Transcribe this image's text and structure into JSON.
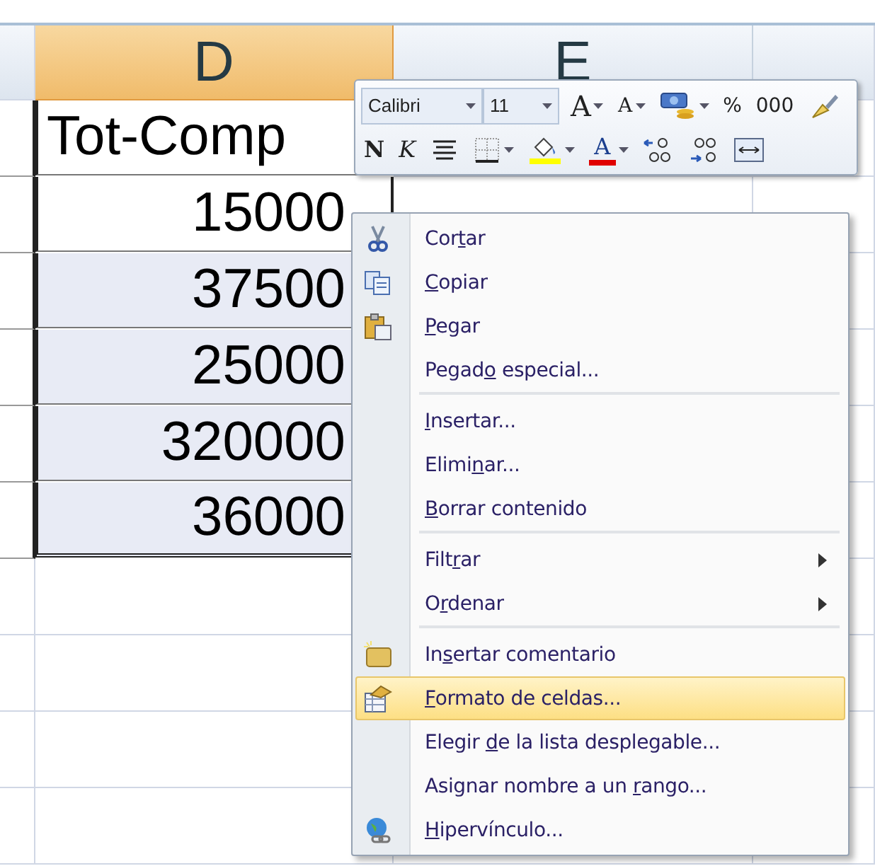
{
  "columns": [
    {
      "label": "D",
      "selected": true
    },
    {
      "label": "E",
      "selected": false
    }
  ],
  "rows": [
    {
      "cell": "Tot-Comp",
      "kind": "header",
      "selected": false
    },
    {
      "cell": "15000",
      "kind": "number",
      "selected": false
    },
    {
      "cell": "37500",
      "kind": "number",
      "selected": true
    },
    {
      "cell": "25000",
      "kind": "number",
      "selected": true
    },
    {
      "cell": "320000",
      "kind": "number",
      "selected": true
    },
    {
      "cell": "36000",
      "kind": "number",
      "selected": true
    }
  ],
  "mini_toolbar": {
    "font": "Calibri",
    "size": "11",
    "row_1": [
      {
        "kind": "grow",
        "text": "A"
      },
      {
        "kind": "shrink",
        "text": "A"
      },
      {
        "kind": "currency"
      },
      {
        "kind": "text",
        "text": "%"
      },
      {
        "kind": "text",
        "text": "000"
      },
      {
        "kind": "brush"
      }
    ],
    "row_2": [
      {
        "kind": "bold",
        "text": "N"
      },
      {
        "kind": "italic",
        "text": "K"
      },
      {
        "kind": "center"
      },
      {
        "kind": "borders"
      },
      {
        "kind": "fill"
      },
      {
        "kind": "fontcolor",
        "text": "A"
      },
      {
        "kind": "incdec"
      },
      {
        "kind": "decdec"
      },
      {
        "kind": "merge"
      }
    ]
  },
  "context_menu": [
    {
      "kind": "cut",
      "before": "Cor",
      "key": "t",
      "after": "ar",
      "selected": false
    },
    {
      "kind": "copy",
      "key": "C",
      "after": "opiar",
      "selected": false
    },
    {
      "kind": "paste",
      "key": "P",
      "after": "egar",
      "selected": false
    },
    {
      "kind": "plain",
      "before": "Pegad",
      "key": "o",
      "after": " especial...",
      "selected": false
    },
    {
      "kind": "separator"
    },
    {
      "kind": "plain",
      "key": "I",
      "after": "nsertar...",
      "selected": false
    },
    {
      "kind": "plain",
      "before": "Elimi",
      "key": "n",
      "after": "ar...",
      "selected": false
    },
    {
      "kind": "plain",
      "key": "B",
      "after": "orrar contenido",
      "selected": false
    },
    {
      "kind": "separator"
    },
    {
      "kind": "submenu",
      "before": "Filt",
      "key": "r",
      "after": "ar",
      "selected": false
    },
    {
      "kind": "submenu",
      "before": "O",
      "key": "r",
      "after": "denar",
      "selected": false
    },
    {
      "kind": "separator"
    },
    {
      "kind": "comment",
      "before": "In",
      "key": "s",
      "after": "ertar comentario",
      "selected": false
    },
    {
      "kind": "format",
      "key": "F",
      "after": "ormato de celdas...",
      "selected": true
    },
    {
      "kind": "plain",
      "before": "Elegir ",
      "key": "d",
      "after": "e la lista desplegable...",
      "selected": false
    },
    {
      "kind": "plain",
      "before": "Asignar nombre a un ",
      "key": "r",
      "after": "ango...",
      "selected": false
    },
    {
      "kind": "link",
      "key": "H",
      "after": "ipervínculo...",
      "selected": false
    }
  ]
}
